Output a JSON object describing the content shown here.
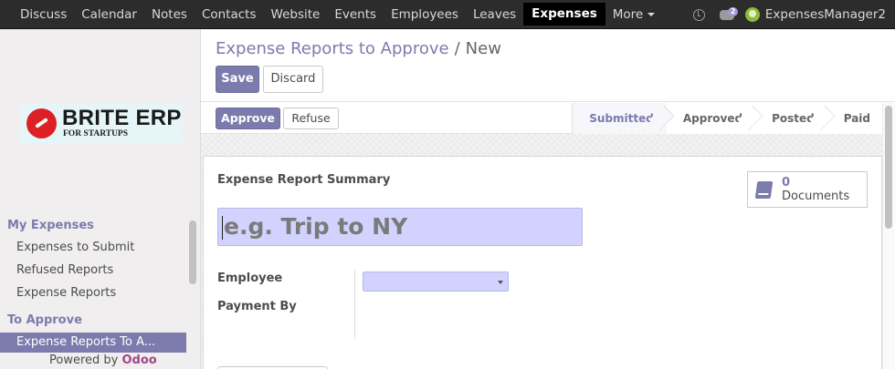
{
  "topnav": {
    "items": [
      "Discuss",
      "Calendar",
      "Notes",
      "Contacts",
      "Website",
      "Events",
      "Employees",
      "Leaves",
      "Expenses",
      "More"
    ],
    "active": "Expenses",
    "icons": [
      "clock-icon",
      "chat-icon"
    ],
    "chat_count": "2",
    "user": "ExpensesManager2"
  },
  "sidebar": {
    "logo": {
      "name": "BRITE ERP",
      "tagline": "FOR STARTUPS"
    },
    "sections": [
      {
        "title": "My Expenses",
        "items": [
          "Expenses to Submit",
          "Refused Reports",
          "Expense Reports"
        ]
      },
      {
        "title": "To Approve",
        "items": [
          "Expense Reports To A..."
        ]
      }
    ],
    "powered_prefix": "Powered by",
    "powered_brand": "Odoo"
  },
  "breadcrumb": {
    "parent": "Expense Reports to Approve",
    "separator": "/",
    "current": "New"
  },
  "buttons": {
    "save": "Save",
    "discard": "Discard",
    "approve": "Approve",
    "refuse": "Refuse"
  },
  "stages": [
    "Submitted",
    "Approved",
    "Posted",
    "Paid"
  ],
  "current_stage": "Submitted",
  "form": {
    "summary_label": "Expense Report Summary",
    "title_placeholder": "e.g. Trip to NY",
    "documents_count": "0",
    "documents_label": "Documents",
    "employee_label": "Employee",
    "employee_value": "",
    "payment_label": "Payment By"
  },
  "colors": {
    "accent": "#7c7bad",
    "topbar": "#2c2c2c",
    "input_bg": "#d2d2ff",
    "brand_odoo": "#a24689"
  }
}
